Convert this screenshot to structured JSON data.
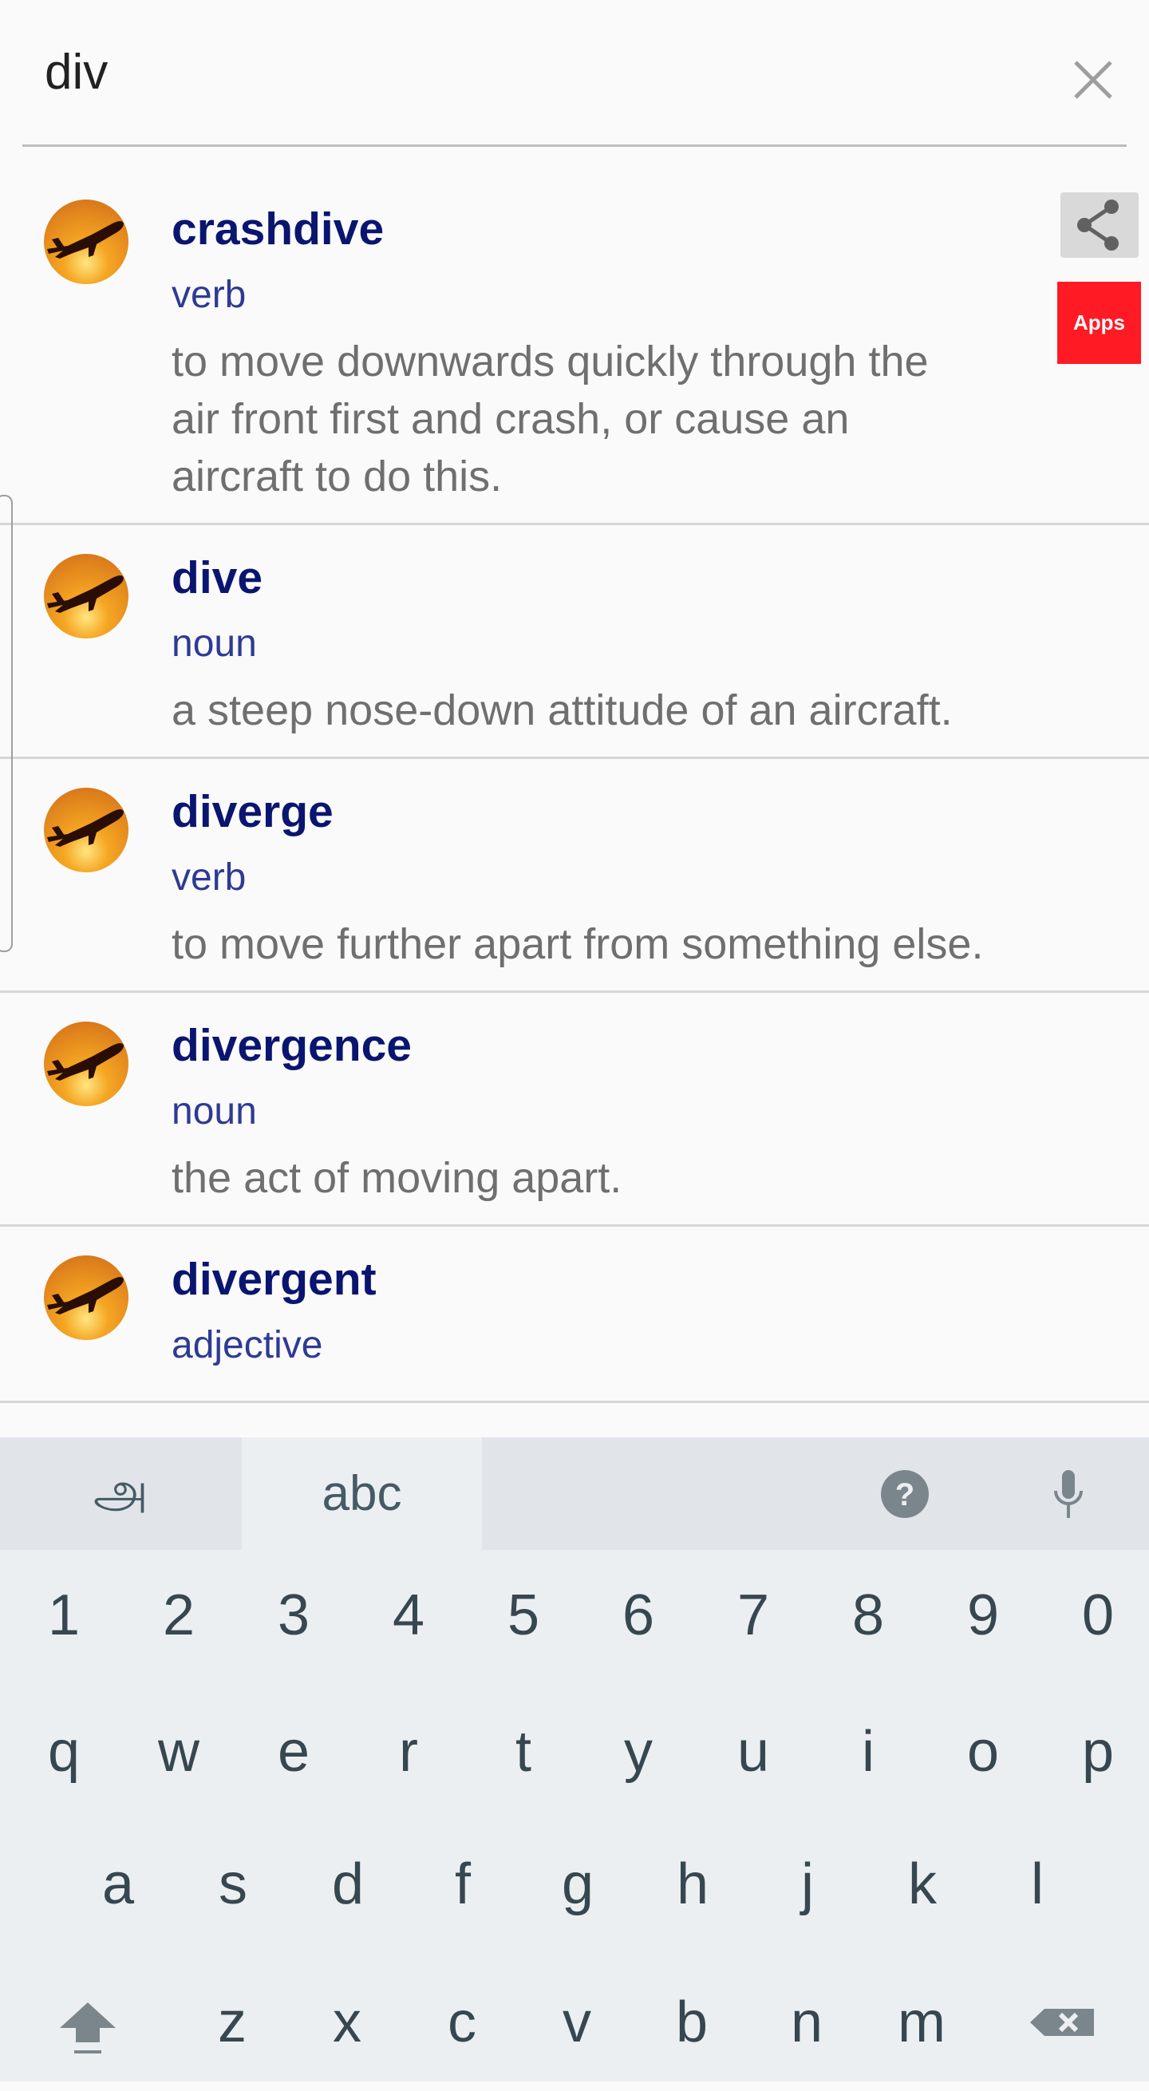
{
  "search": {
    "value": "div",
    "clear_icon": "close-icon"
  },
  "results": [
    {
      "word": "crashdive",
      "pos": "verb",
      "definition": "to move downwards quickly through the air front first and crash, or cause an aircraft to do this."
    },
    {
      "word": "dive",
      "pos": "noun",
      "definition": "a steep nose-down attitude of an aircraft."
    },
    {
      "word": "diverge",
      "pos": "verb",
      "definition": "to move further apart from something else."
    },
    {
      "word": "divergence",
      "pos": "noun",
      "definition": "the act of moving apart."
    },
    {
      "word": "divergent",
      "pos": "adjective",
      "definition": ""
    }
  ],
  "side": {
    "share_icon": "share-icon",
    "apps_label": "Apps",
    "apps_color": "#ff1a24"
  },
  "colors": {
    "word": "#0a1570",
    "pos": "#2e3a94",
    "definition": "#6f6f6f"
  },
  "keyboard": {
    "tabs": {
      "tamil": "அ",
      "abc": "abc"
    },
    "numbers": [
      "1",
      "2",
      "3",
      "4",
      "5",
      "6",
      "7",
      "8",
      "9",
      "0"
    ],
    "row1": [
      "q",
      "w",
      "e",
      "r",
      "t",
      "y",
      "u",
      "i",
      "o",
      "p"
    ],
    "row2": [
      "a",
      "s",
      "d",
      "f",
      "g",
      "h",
      "j",
      "k",
      "l"
    ],
    "row3": [
      "z",
      "x",
      "c",
      "v",
      "b",
      "n",
      "m"
    ]
  }
}
